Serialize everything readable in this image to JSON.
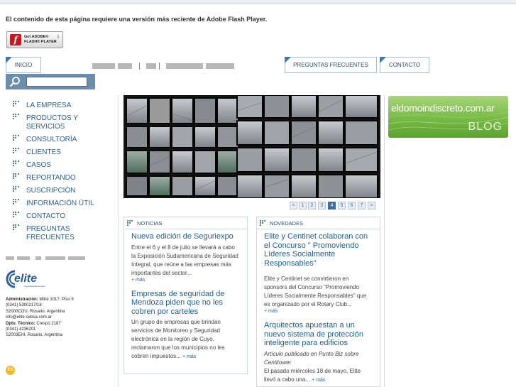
{
  "flash": {
    "message": "El contenido de esta página requiere una versión más reciente de Adobe Flash Player.",
    "button_line1": "Get ADOBE®",
    "button_line2": "FLASH® PLAYER"
  },
  "topnav": {
    "inicio": "INICIO",
    "preguntas": "PREGUNTAS FRECUENTES",
    "contacto": "CONTACTO"
  },
  "search": {
    "placeholder": ""
  },
  "menu": [
    "LA EMPRESA",
    "PRODUCTOS Y SERVICIOS",
    "CONSULTORÍA",
    "CLIENTES",
    "CASOS",
    "REPORTANDO",
    "SUSCRIPCIÓN",
    "INFORMACIÓN ÚTIL",
    "CONTACTO",
    "PREGUNTAS FRECUENTES"
  ],
  "logo": {
    "text": "elite",
    "tagline": "Seguridad Electrónica"
  },
  "contact": {
    "admin_label": "Administración:",
    "admin_address": "Mitre 1017. Piso 9",
    "admin_phone": "(0341) 5300217/18",
    "admin_city": "S2000COU. Rosario. Argentina",
    "email": "info@elite-sebsa.com.ar",
    "tech_label": "Dpto. Técnico:",
    "tech_address": "Crespo 2187",
    "tech_phone": "(0341) 4236201",
    "tech_city": "S2003EHI. Rosario. Argentina"
  },
  "badge": "ES",
  "pager": {
    "pages": [
      "<",
      "1",
      "2",
      "3",
      "4",
      "5",
      "6",
      "7",
      ">"
    ],
    "active": "4"
  },
  "noticias": {
    "title": "NOTICIAS",
    "articles": [
      {
        "headline": "Nueva edición de Seguriexpo",
        "body": "Entre el 6 y el 8 de julio se llevará a cabo la Exposición Sudamericana de Seguridad Integral, que reúne a las empresas más importantes del sector...",
        "more": "+ más"
      },
      {
        "headline": "Empresas de seguridad de Mendoza piden que no les cobren por carteles",
        "body": "Un grupo de empresas que brindan servicios de Monitoreo y Seguridad electrónica en la región de Cuyo, reclamaron que los municipios no les cobren impuestos...",
        "more": "+ más"
      }
    ]
  },
  "novedades": {
    "title": "NOVEDADES",
    "articles": [
      {
        "headline": "Elite y Centinet colaboran con el Concurso \" Promoviendo Líderes Socialmente Responsables\"",
        "body": "Elite y Centinet se convirtieron en sponsors del Concurso \"Promoviendo Líderes Socialmente Responsables\" que es organizado por el Rotary Club...",
        "more": "+ más"
      },
      {
        "headline": "Arquitectos apuestan a un nuevo sistema de protección inteligente para edificios",
        "subtitle": "Artículo publicado en Punto Biz sobre Centitower",
        "body": "El pasado miércoles 18 de mayo, Elite llevó a cabo una...",
        "more": "+ más"
      }
    ]
  },
  "blog": {
    "url": "eldomoindiscreto.com.ar",
    "label": "BLOG"
  },
  "colors": {
    "accent": "#3c6d98",
    "link": "#1e5f95",
    "blog_green": "#7fbf4c"
  }
}
